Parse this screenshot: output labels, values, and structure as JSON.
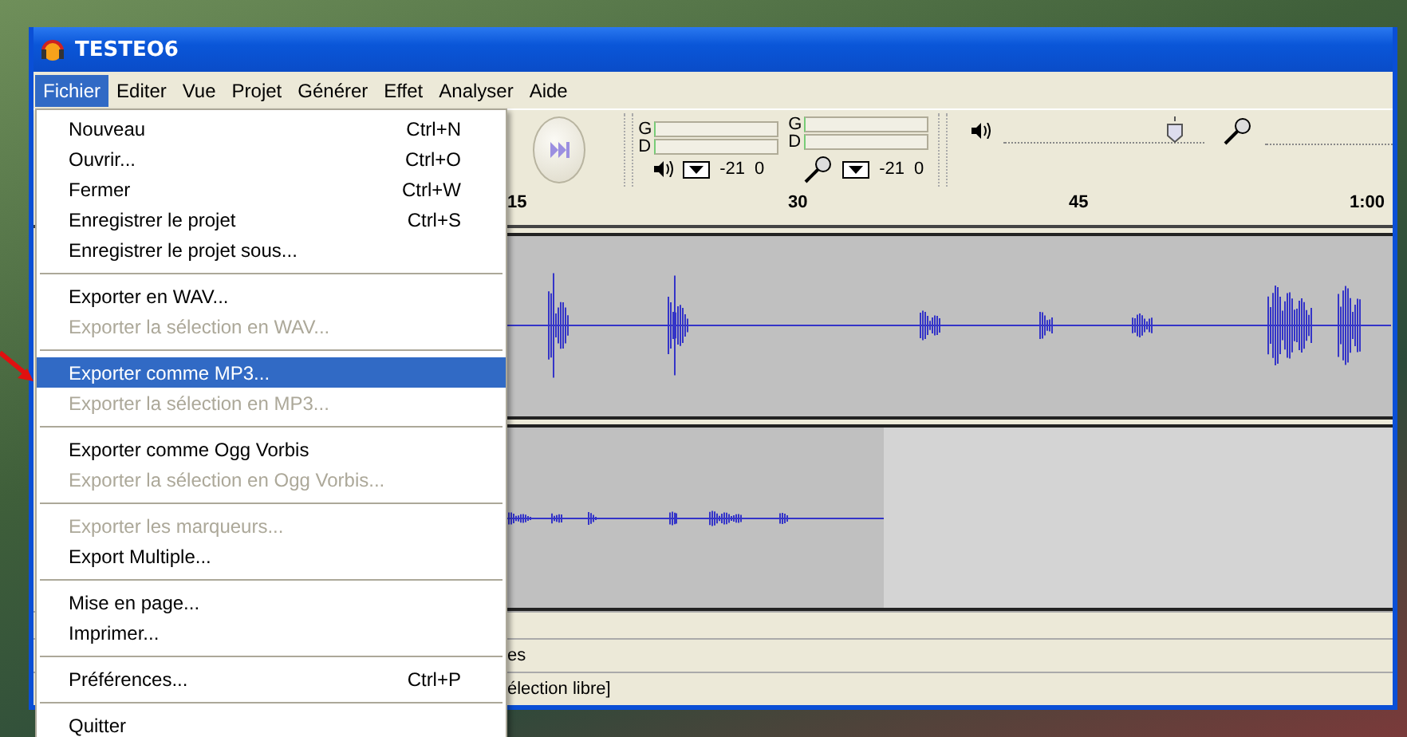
{
  "window": {
    "title": "TESTEO6"
  },
  "menu_bar": [
    {
      "label": "Fichier",
      "selected": true
    },
    {
      "label": "Editer",
      "selected": false
    },
    {
      "label": "Vue",
      "selected": false
    },
    {
      "label": "Projet",
      "selected": false
    },
    {
      "label": "Générer",
      "selected": false
    },
    {
      "label": "Effet",
      "selected": false
    },
    {
      "label": "Analyser",
      "selected": false
    },
    {
      "label": "Aide",
      "selected": false
    }
  ],
  "file_menu": {
    "groups": [
      [
        {
          "label": "Nouveau",
          "shortcut": "Ctrl+N",
          "disabled": false,
          "selected": false
        },
        {
          "label": "Ouvrir...",
          "shortcut": "Ctrl+O",
          "disabled": false,
          "selected": false
        },
        {
          "label": "Fermer",
          "shortcut": "Ctrl+W",
          "disabled": false,
          "selected": false
        },
        {
          "label": "Enregistrer le projet",
          "shortcut": "Ctrl+S",
          "disabled": false,
          "selected": false
        },
        {
          "label": "Enregistrer le projet sous...",
          "disabled": false,
          "selected": false
        }
      ],
      [
        {
          "label": "Exporter en WAV...",
          "disabled": false,
          "selected": false
        },
        {
          "label": "Exporter la sélection en WAV...",
          "disabled": true,
          "selected": false
        }
      ],
      [
        {
          "label": "Exporter comme MP3...",
          "disabled": false,
          "selected": true
        },
        {
          "label": "Exporter la sélection en MP3...",
          "disabled": true,
          "selected": false
        }
      ],
      [
        {
          "label": "Exporter comme Ogg Vorbis",
          "disabled": false,
          "selected": false
        },
        {
          "label": "Exporter la sélection en Ogg Vorbis...",
          "disabled": true,
          "selected": false
        }
      ],
      [
        {
          "label": "Exporter les marqueurs...",
          "disabled": true,
          "selected": false
        },
        {
          "label": "Export Multiple...",
          "disabled": false,
          "selected": false
        }
      ],
      [
        {
          "label": "Mise en page...",
          "disabled": false,
          "selected": false
        },
        {
          "label": "Imprimer...",
          "disabled": false,
          "selected": false
        }
      ],
      [
        {
          "label": "Préférences...",
          "shortcut": "Ctrl+P",
          "disabled": false,
          "selected": false
        }
      ],
      [
        {
          "label": "Quitter",
          "disabled": false,
          "selected": false
        }
      ]
    ]
  },
  "toolbar": {
    "meters": [
      {
        "kind": "playback",
        "channels": [
          "G",
          "D"
        ],
        "scale": [
          "-21",
          "0"
        ]
      },
      {
        "kind": "recording",
        "channels": [
          "G",
          "D"
        ],
        "scale": [
          "-21",
          "0"
        ]
      }
    ],
    "sliders": [
      {
        "kind": "playback",
        "level": 0.85
      },
      {
        "kind": "recording"
      }
    ]
  },
  "ruler": {
    "ticks": [
      "15",
      "30",
      "45",
      "1:00"
    ]
  },
  "status_bar": [
    "es",
    "élection libre]"
  ]
}
